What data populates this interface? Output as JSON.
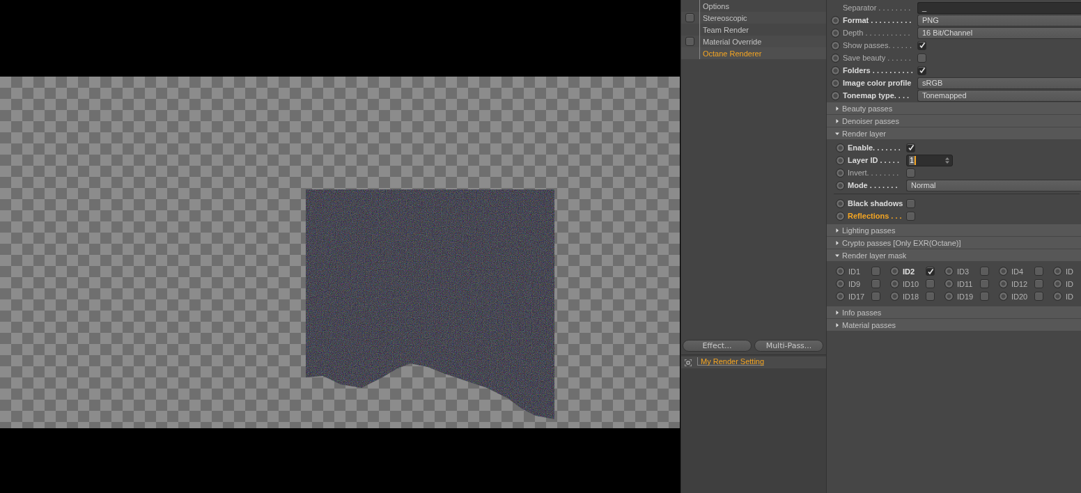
{
  "viewport": {
    "render_region": true
  },
  "tree": {
    "items": [
      {
        "label": "Options",
        "kind": "plain",
        "selected": false
      },
      {
        "label": "Stereoscopic",
        "kind": "toggle",
        "checked": false,
        "selected": false
      },
      {
        "label": "Team Render",
        "kind": "plain",
        "selected": false
      },
      {
        "label": "Material Override",
        "kind": "toggle",
        "checked": false,
        "selected": false
      },
      {
        "label": "Octane Renderer",
        "kind": "plain",
        "selected": true
      }
    ],
    "buttons": [
      "Effect...",
      "Multi-Pass..."
    ],
    "settings_list": [
      {
        "label": "My Render Setting",
        "selected": true
      }
    ]
  },
  "attributes": {
    "separator": {
      "label": "Separator . . . . . . . .",
      "value": "_"
    },
    "rows": [
      {
        "kind": "dropdown",
        "label": "Format . . . . . . . . . .",
        "emphasis": true,
        "value": "PNG"
      },
      {
        "kind": "dropdown",
        "label": "Depth . . . . . . . . . . .",
        "emphasis": false,
        "value": "16 Bit/Channel"
      },
      {
        "kind": "checkbox",
        "label": "Show passes. . . . . .",
        "emphasis": false,
        "checked": true
      },
      {
        "kind": "checkbox",
        "label": "Save beauty . . . . . .",
        "emphasis": false,
        "checked": false
      },
      {
        "kind": "checkbox",
        "label": "Folders . . . . . . . . . .",
        "emphasis": true,
        "checked": true
      },
      {
        "kind": "dropdown",
        "label": "Image color profile",
        "emphasis": true,
        "value": "sRGB"
      },
      {
        "kind": "dropdown",
        "label": "Tonemap type. . . .",
        "emphasis": true,
        "value": "Tonemapped"
      }
    ],
    "sections": [
      {
        "title": "Beauty passes",
        "expanded": false
      },
      {
        "title": "Denoiser passes",
        "expanded": false
      },
      {
        "title": "Render layer",
        "expanded": true,
        "groups": [
          [
            {
              "kind": "checkbox",
              "label": "Enable. . . . . . .",
              "emphasis": true,
              "highlighted": false,
              "checked": true
            },
            {
              "kind": "spinner",
              "label": "Layer ID . . . . .",
              "emphasis": true,
              "highlighted": false,
              "value": "1"
            },
            {
              "kind": "checkbox",
              "label": "Invert. . . . . . . .",
              "emphasis": false,
              "highlighted": false,
              "checked": false
            },
            {
              "kind": "dropdown",
              "label": "Mode . . . . . . .",
              "emphasis": true,
              "highlighted": false,
              "value": "Normal"
            }
          ],
          [
            {
              "kind": "checkbox",
              "label": "Black shadows",
              "emphasis": true,
              "highlighted": false,
              "checked": false
            },
            {
              "kind": "checkbox",
              "label": "Reflections . . .",
              "emphasis": true,
              "highlighted": true,
              "checked": false
            }
          ]
        ]
      },
      {
        "title": "Lighting passes",
        "expanded": false
      },
      {
        "title": "Crypto passes [Only EXR(Octane)]",
        "expanded": false
      },
      {
        "title": "Render layer mask",
        "expanded": true,
        "mask": [
          {
            "label": "ID1",
            "emphasis": false,
            "checked": false
          },
          {
            "label": "ID2",
            "emphasis": true,
            "checked": true
          },
          {
            "label": "ID3",
            "emphasis": false,
            "checked": false
          },
          {
            "label": "ID4",
            "emphasis": false,
            "checked": false
          },
          {
            "label": "ID",
            "emphasis": false
          },
          {
            "label": "ID9",
            "emphasis": false,
            "checked": false
          },
          {
            "label": "ID10",
            "emphasis": false,
            "checked": false
          },
          {
            "label": "ID11",
            "emphasis": false,
            "checked": false
          },
          {
            "label": "ID12",
            "emphasis": false,
            "checked": false
          },
          {
            "label": "ID",
            "emphasis": false
          },
          {
            "label": "ID17",
            "emphasis": false,
            "checked": false
          },
          {
            "label": "ID18",
            "emphasis": false,
            "checked": false
          },
          {
            "label": "ID19",
            "emphasis": false,
            "checked": false
          },
          {
            "label": "ID20",
            "emphasis": false,
            "checked": false
          },
          {
            "label": "ID",
            "emphasis": false
          }
        ]
      },
      {
        "title": "Info passes",
        "expanded": false
      },
      {
        "title": "Material passes",
        "expanded": false
      }
    ]
  }
}
